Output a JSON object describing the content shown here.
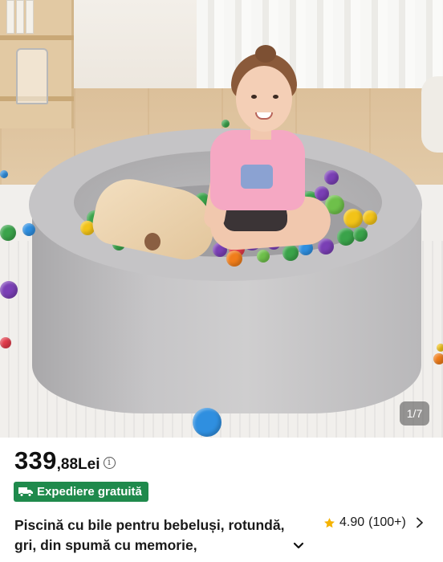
{
  "gallery": {
    "counter": "1/7"
  },
  "price": {
    "integer": "339",
    "decimal": ",88",
    "currency": "Lei",
    "info_glyph": "i"
  },
  "shipping_badge": {
    "label": "Expediere gratuită",
    "icon": "truck-icon",
    "color": "#1f8a4c"
  },
  "product": {
    "title": "Piscină cu bile pentru bebeluși, rotundă, gri, din spumă cu memorie, ",
    "expand_icon": "chevron-down-icon"
  },
  "rating": {
    "score": "4.90",
    "count": "(100+)",
    "star_color": "#f5b301",
    "icon": "star-icon"
  },
  "photo": {
    "subject": "pool-photo",
    "ball_colors": [
      "#3aa34a",
      "#7a3fb5",
      "#f2c318",
      "#e23b4a",
      "#2f8fe0",
      "#f07d1a",
      "#6ec04a",
      "#c52f8a"
    ]
  }
}
